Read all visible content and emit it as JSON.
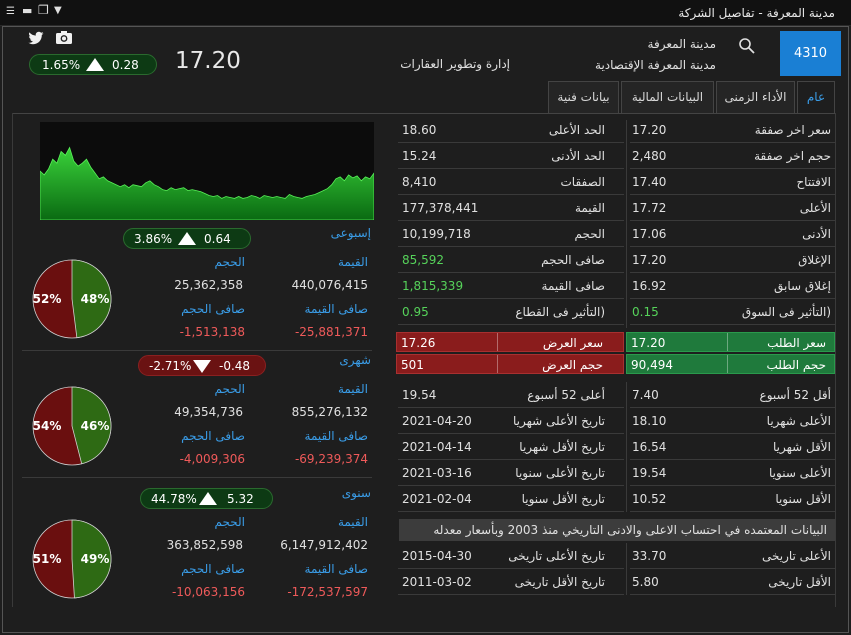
{
  "window": {
    "title": "مدينة المعرفة - تفاصيل الشركة"
  },
  "header": {
    "symbol": "4310",
    "company_name": "مدينة المعرفة",
    "company_full": "مدينة المعرفة الإقتصادية",
    "sector": "إدارة وتطوير العقارات",
    "price": "17.20",
    "change": "0.28",
    "change_pct": "1.65%",
    "change_dir": "up"
  },
  "tabs": [
    {
      "label": "عام",
      "active": true
    },
    {
      "label": "الأداء الزمنى",
      "active": false
    },
    {
      "label": "البيانات المالية",
      "active": false
    },
    {
      "label": "بيانات فنية",
      "active": false
    }
  ],
  "stats_right": [
    {
      "label": "سعر اخر صفقة",
      "value": "17.20"
    },
    {
      "label": "حجم اخر صفقة",
      "value": "2,480"
    },
    {
      "label": "الافتتاح",
      "value": "17.40"
    },
    {
      "label": "الأعلى",
      "value": "17.72"
    },
    {
      "label": "الأدنى",
      "value": "17.06"
    },
    {
      "label": "الإغلاق",
      "value": "17.20"
    },
    {
      "label": "إغلاق سابق",
      "value": "16.92"
    },
    {
      "label": "(التأثير فى السوق",
      "value": "0.15",
      "color": "green"
    }
  ],
  "stats_left": [
    {
      "label": "الحد الأعلى",
      "value": "18.60"
    },
    {
      "label": "الحد الأدنى",
      "value": "15.24"
    },
    {
      "label": "الصفقات",
      "value": "8,410"
    },
    {
      "label": "القيمة",
      "value": "177,378,441"
    },
    {
      "label": "الحجم",
      "value": "10,199,718"
    },
    {
      "label": "صافى الحجم",
      "value": "85,592",
      "color": "green"
    },
    {
      "label": "صافى القيمة",
      "value": "1,815,339",
      "color": "green"
    },
    {
      "label": "(التأثير فى القطاع",
      "value": "0.95",
      "color": "green"
    }
  ],
  "orderbook": {
    "bid_price_label": "سعر الطلب",
    "bid_price": "17.20",
    "bid_volume_label": "حجم الطلب",
    "bid_volume": "90,494",
    "ask_price_label": "سعر العرض",
    "ask_price": "17.26",
    "ask_volume_label": "حجم العرض",
    "ask_volume": "501"
  },
  "ranges_right": [
    {
      "label": "أقل 52 أسبوع",
      "value": "7.40"
    },
    {
      "label": "الأعلى شهريا",
      "value": "18.10"
    },
    {
      "label": "الأقل شهريا",
      "value": "16.54"
    },
    {
      "label": "الأعلى سنويا",
      "value": "19.54"
    },
    {
      "label": "الأقل سنويا",
      "value": "10.52"
    }
  ],
  "ranges_left": [
    {
      "label": "أعلى 52 أسبوع",
      "value": "19.54"
    },
    {
      "label": "تاريخ الأعلى شهريا",
      "value": "2021-04-20"
    },
    {
      "label": "تاريخ الأقل شهريا",
      "value": "2021-04-14"
    },
    {
      "label": "تاريخ الأعلى سنويا",
      "value": "2021-03-16"
    },
    {
      "label": "تاريخ الأقل سنويا",
      "value": "2021-02-04"
    }
  ],
  "history_note": "البيانات المعتمده في احتساب الاعلى والادنى التاريخي منذ  2003  وبأسعار معدله",
  "history_right": [
    {
      "label": "الأعلى تاريخى",
      "value": "33.70"
    },
    {
      "label": "الأقل تاريخى",
      "value": "5.80"
    }
  ],
  "history_left": [
    {
      "label": "تاريخ الأعلى تاريخى",
      "value": "2015-04-30"
    },
    {
      "label": "تاريخ الأقل تاريخى",
      "value": "2011-03-02"
    }
  ],
  "periods": [
    {
      "name": "إسبوعى",
      "change": "0.64",
      "change_pct": "3.86%",
      "dir": "up",
      "value_label": "القيمة",
      "volume_label": "الحجم",
      "net_value_label": "صافى القيمة",
      "net_volume_label": "صافى الحجم",
      "value": "440,076,415",
      "volume": "25,362,358",
      "net_value": "-25,881,371",
      "net_volume": "-1,513,138",
      "buy_pct": "48%",
      "sell_pct": "52%",
      "buy_fraction": 0.48
    },
    {
      "name": "شهرى",
      "change": "-0.48",
      "change_pct": "-2.71%",
      "dir": "down",
      "value_label": "القيمة",
      "volume_label": "الحجم",
      "net_value_label": "صافى القيمة",
      "net_volume_label": "صافى الحجم",
      "value": "855,276,132",
      "volume": "49,354,736",
      "net_value": "-69,239,374",
      "net_volume": "-4,009,306",
      "buy_pct": "46%",
      "sell_pct": "54%",
      "buy_fraction": 0.46
    },
    {
      "name": "سنوى",
      "change": "5.32",
      "change_pct": "44.78%",
      "dir": "up",
      "value_label": "القيمة",
      "volume_label": "الحجم",
      "net_value_label": "صافى القيمة",
      "net_volume_label": "صافى الحجم",
      "value": "6,147,912,402",
      "volume": "363,852,598",
      "net_value": "-172,537,597",
      "net_volume": "-10,063,156",
      "buy_pct": "49%",
      "sell_pct": "51%",
      "buy_fraction": 0.49
    }
  ],
  "intraday_series": [
    50,
    46,
    52,
    62,
    58,
    70,
    66,
    74,
    60,
    55,
    58,
    62,
    54,
    48,
    42,
    44,
    40,
    38,
    36,
    34,
    36,
    33,
    36,
    35,
    34,
    38,
    40,
    36,
    34,
    31,
    30,
    33,
    31,
    32,
    33,
    30,
    31,
    30,
    29,
    27,
    25,
    24,
    25,
    22,
    24,
    23,
    22,
    24,
    22,
    23,
    25,
    24,
    22,
    25,
    24,
    23,
    24,
    23,
    22,
    26,
    24,
    23,
    22,
    24,
    25,
    26,
    28,
    30,
    32,
    36,
    42,
    44,
    40,
    46,
    43,
    45,
    40,
    44,
    42,
    48
  ],
  "colors": {
    "accent": "#1a7fd4",
    "bid_green": "#1f7a3c",
    "ask_red": "#8a1c1c",
    "buy_slice": "#2e6a14",
    "sell_slice": "#6a0f0f",
    "positive": "#56d25a",
    "negative": "#ef5a5a"
  },
  "icons": [
    "twitter-icon",
    "camera-icon",
    "search-icon"
  ]
}
